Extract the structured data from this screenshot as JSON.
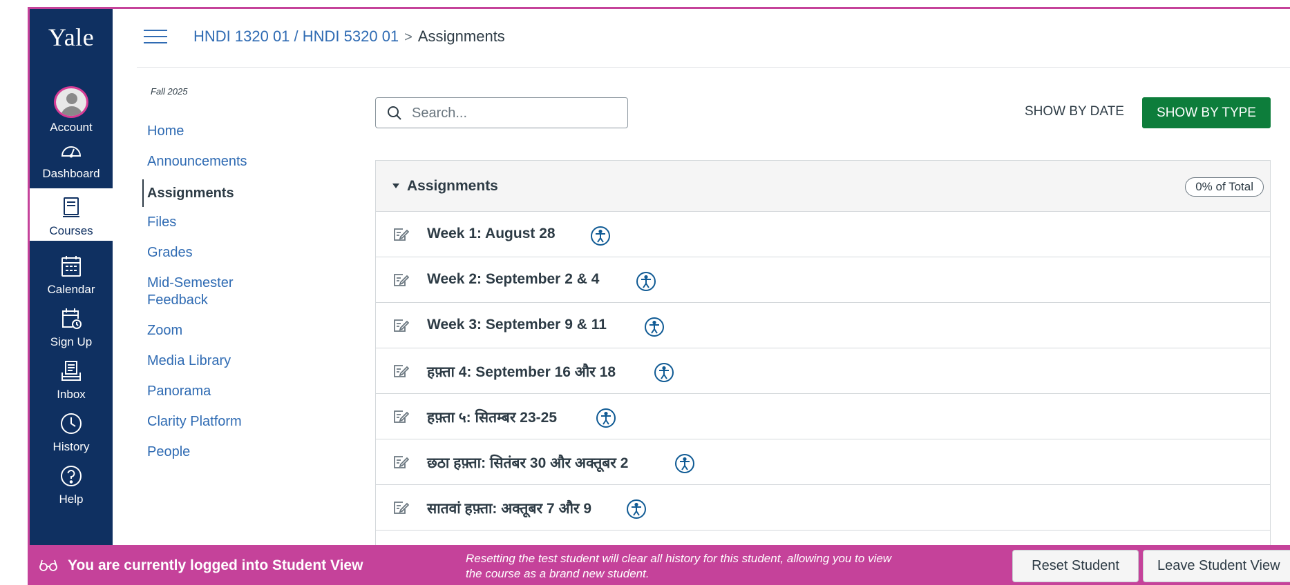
{
  "global_nav": {
    "logo": "Yale",
    "items": [
      {
        "label": "Account",
        "icon": "account-avatar-icon"
      },
      {
        "label": "Dashboard",
        "icon": "dashboard-icon"
      },
      {
        "label": "Courses",
        "icon": "courses-icon",
        "active": true
      },
      {
        "label": "Calendar",
        "icon": "calendar-icon"
      },
      {
        "label": "Sign Up",
        "icon": "sign-up-icon"
      },
      {
        "label": "Inbox",
        "icon": "inbox-icon"
      },
      {
        "label": "History",
        "icon": "history-icon"
      },
      {
        "label": "Help",
        "icon": "help-icon"
      }
    ]
  },
  "header": {
    "course": "HNDI 1320 01 / HNDI 5320 01",
    "separator": ">",
    "current": "Assignments"
  },
  "course_nav": {
    "term": "Fall 2025",
    "items": [
      {
        "label": "Home"
      },
      {
        "label": "Announcements"
      },
      {
        "label": "Assignments",
        "active": true
      },
      {
        "label": "Files"
      },
      {
        "label": "Grades"
      },
      {
        "label": "Mid-Semester Feedback"
      },
      {
        "label": "Zoom"
      },
      {
        "label": "Media Library"
      },
      {
        "label": "Panorama"
      },
      {
        "label": "Clarity Platform"
      },
      {
        "label": "People"
      }
    ]
  },
  "toolbar": {
    "search_placeholder": "Search...",
    "show_by_date": "SHOW BY DATE",
    "show_by_type": "SHOW BY TYPE"
  },
  "assignment_group": {
    "title": "Assignments",
    "weight": "0% of Total",
    "items": [
      {
        "title": "Week 1: August 28"
      },
      {
        "title": "Week 2: September 2 & 4"
      },
      {
        "title": "Week 3: September 9 & 11"
      },
      {
        "title": "हफ़्ता 4: September 16 और 18"
      },
      {
        "title": "हफ़्ता ५: सितम्बर 23-25"
      },
      {
        "title": "छठा हफ़्ता: सितंबर 30 और अक्तूबर 2"
      },
      {
        "title": "सातवां हफ़्ता: अक्तूबर 7 और 9"
      }
    ]
  },
  "student_view": {
    "label": "You are currently logged into Student View",
    "description": "Resetting the test student will clear all history for this student, allowing you to view the course as a brand new student.",
    "reset_button": "Reset Student",
    "leave_button": "Leave Student View"
  },
  "colors": {
    "nav_bg": "#0f3061",
    "link": "#2f6bb3",
    "primary_button": "#0d7d3b",
    "student_view_bar": "#c5429a"
  }
}
